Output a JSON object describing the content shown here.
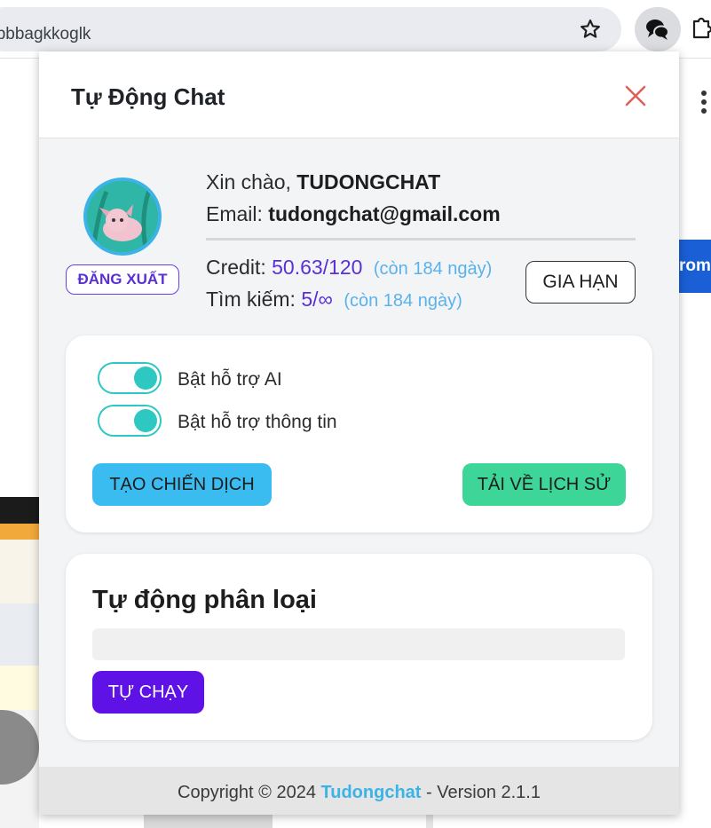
{
  "browser": {
    "url_text": "clpbbagkkoglk"
  },
  "background_page": {
    "banner_text": "rome"
  },
  "popup": {
    "title": "Tự Động Chat",
    "profile": {
      "greeting_prefix": "Xin chào, ",
      "username": "TUDONGCHAT",
      "email_label": "Email: ",
      "email": "tudongchat@gmail.com",
      "logout_label": "ĐĂNG XUẤT"
    },
    "stats": {
      "credit_label": "Credit: ",
      "credit_value": "50.63/120",
      "credit_note": "(còn 184 ngày)",
      "search_label": "Tìm kiếm: ",
      "search_value": "5/∞",
      "search_note": "(còn 184 ngày)",
      "renew_label": "GIA HẠN"
    },
    "toggles": [
      {
        "label": "Bật hỗ trợ AI",
        "on": true
      },
      {
        "label": "Bật hỗ trợ thông tin",
        "on": true
      }
    ],
    "actions": {
      "campaign_label": "TẠO CHIẾN DỊCH",
      "history_label": "TẢI VỀ LỊCH SỬ"
    },
    "classify": {
      "title": "Tự động phân loại",
      "progress": 0,
      "run_label": "TỰ CHẠY"
    },
    "footer": {
      "prefix": "Copyright © 2024 ",
      "brand": "Tudongchat",
      "suffix": " - Version 2.1.1"
    },
    "colors": {
      "accent_purple": "#5b2fd6",
      "accent_blue": "#3bbcf0",
      "accent_green": "#3dd598",
      "toggle_teal": "#2ec8c2",
      "close_red": "#e0605a"
    }
  }
}
